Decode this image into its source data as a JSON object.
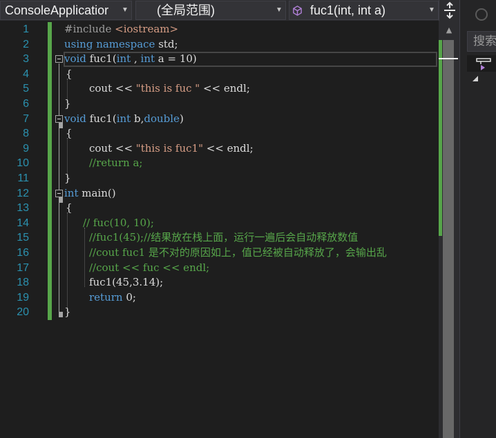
{
  "navbar": {
    "project_combo": "ConsoleApplicatior",
    "scope_combo": "(全局范围)",
    "member_combo": "fuc1(int, int a)"
  },
  "editor": {
    "line_numbers": [
      "1",
      "2",
      "3",
      "4",
      "5",
      "6",
      "7",
      "8",
      "9",
      "10",
      "11",
      "12",
      "13",
      "14",
      "15",
      "16",
      "17",
      "18",
      "19",
      "20"
    ],
    "lines": {
      "l1_directive": "#include",
      "l1_header": "<iostream>",
      "l2_using": "using",
      "l2_namespace": "namespace",
      "l2_rest": " std;",
      "l3_void": "void",
      "l3_name": "fuc1",
      "l3_open": "(",
      "l3_int1": "int",
      "l3_mid": " , ",
      "l3_int2": "int",
      "l3_rest": " a = 10)",
      "l4": "{",
      "l5_cout": "cout << ",
      "l5_str": "\"this is fuc \"",
      "l5_rest": " << endl;",
      "l6": "}",
      "l7_void": "void",
      "l7_name": "fuc1",
      "l7_open": "(",
      "l7_int": "int",
      "l7_mid": " b,",
      "l7_double": "double",
      "l7_close": ")",
      "l8": "{",
      "l9_cout": "cout << ",
      "l9_str": "\"this is fuc1\"",
      "l9_rest": " << endl;",
      "l10": "//return a;",
      "l11": "}",
      "l12_int": "int",
      "l12_rest": " main()",
      "l13": "{",
      "l14": "// fuc(10, 10);",
      "l15": "//fuc1(45);//结果放在栈上面，运行一遍后会自动释放数值",
      "l16": "//cout fuc1 是不对的原因如上，值已经被自动释放了，会输出乱",
      "l17": "//cout << fuc << endl;",
      "l18": "fuc1(45,3.14);",
      "l19_return": "return",
      "l19_rest": " 0;",
      "l20": "}"
    }
  },
  "right_pane": {
    "search_placeholder": "搜索"
  },
  "colors": {
    "keyword": "#569cd6",
    "preprocessor": "#9b9b9b",
    "string": "#d69d85",
    "comment": "#57a64a",
    "line_number": "#2b91af",
    "change_bar": "#57a64a",
    "editor_bg": "#1e1e1e"
  },
  "icons": {
    "member_combo": "cube-member-icon",
    "split": "split-window-icon",
    "back": "circle-back-icon",
    "project_node": "project-node-icon"
  }
}
